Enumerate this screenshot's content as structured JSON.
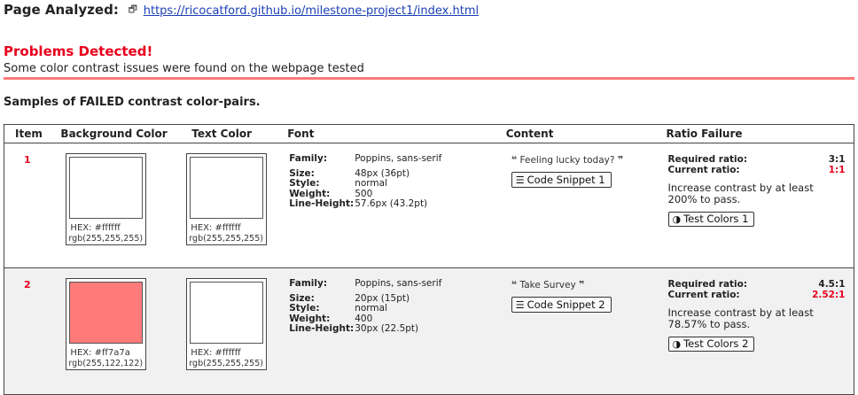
{
  "header": {
    "label": "Page Analyzed:",
    "url": "https://ricocatford.github.io/milestone-project1/index.html",
    "external_icon": "external-link-icon"
  },
  "problems": {
    "title": "Problems Detected!",
    "subtitle": "Some color contrast issues were found on the webpage tested",
    "rule_color": "#ff7a7a"
  },
  "samples_heading": "Samples of FAILED contrast color-pairs.",
  "table": {
    "headers": {
      "item": "Item",
      "background": "Background Color",
      "text": "Text Color",
      "font": "Font",
      "content": "Content",
      "ratio": "Ratio Failure"
    },
    "font_labels": {
      "family": "Family:",
      "size": "Size:",
      "style": "Style:",
      "weight": "Weight:",
      "line_height": "Line-Height:"
    },
    "ratio_labels": {
      "required": "Required ratio:",
      "current": "Current ratio:"
    },
    "rows": [
      {
        "item": "1",
        "bg_hex": "HEX: #ffffff",
        "bg_rgb": "rgb(255,255,255)",
        "bg_color": "#ffffff",
        "text_hex": "HEX: #ffffff",
        "text_rgb": "rgb(255,255,255)",
        "text_color": "#ffffff",
        "family": "Poppins, sans-serif",
        "size": "48px (36pt)",
        "style": "normal",
        "weight": "500",
        "line_height": "57.6px (43.2pt)",
        "content_text": "Feeling lucky today?",
        "snippet_button": "Code Snippet 1",
        "required": "3:1",
        "current": "1:1",
        "message": "Increase contrast by at least 200% to pass.",
        "test_button": "Test Colors 1"
      },
      {
        "item": "2",
        "bg_hex": "HEX: #ff7a7a",
        "bg_rgb": "rgb(255,122,122)",
        "bg_color": "#ff7a7a",
        "text_hex": "HEX: #ffffff",
        "text_rgb": "rgb(255,255,255)",
        "text_color": "#ffffff",
        "family": "Poppins, sans-serif",
        "size": "20px (15pt)",
        "style": "normal",
        "weight": "400",
        "line_height": "30px (22.5pt)",
        "content_text": "Take Survey",
        "snippet_button": "Code Snippet 2",
        "required": "4.5:1",
        "current": "2.52:1",
        "message": "Increase contrast by at least 78.57% to pass.",
        "test_button": "Test Colors 2"
      }
    ]
  },
  "colors": {
    "error_red": "#e8001c",
    "link_blue": "#1a3fb5",
    "row_alt_bg": "#f1f1f1"
  }
}
